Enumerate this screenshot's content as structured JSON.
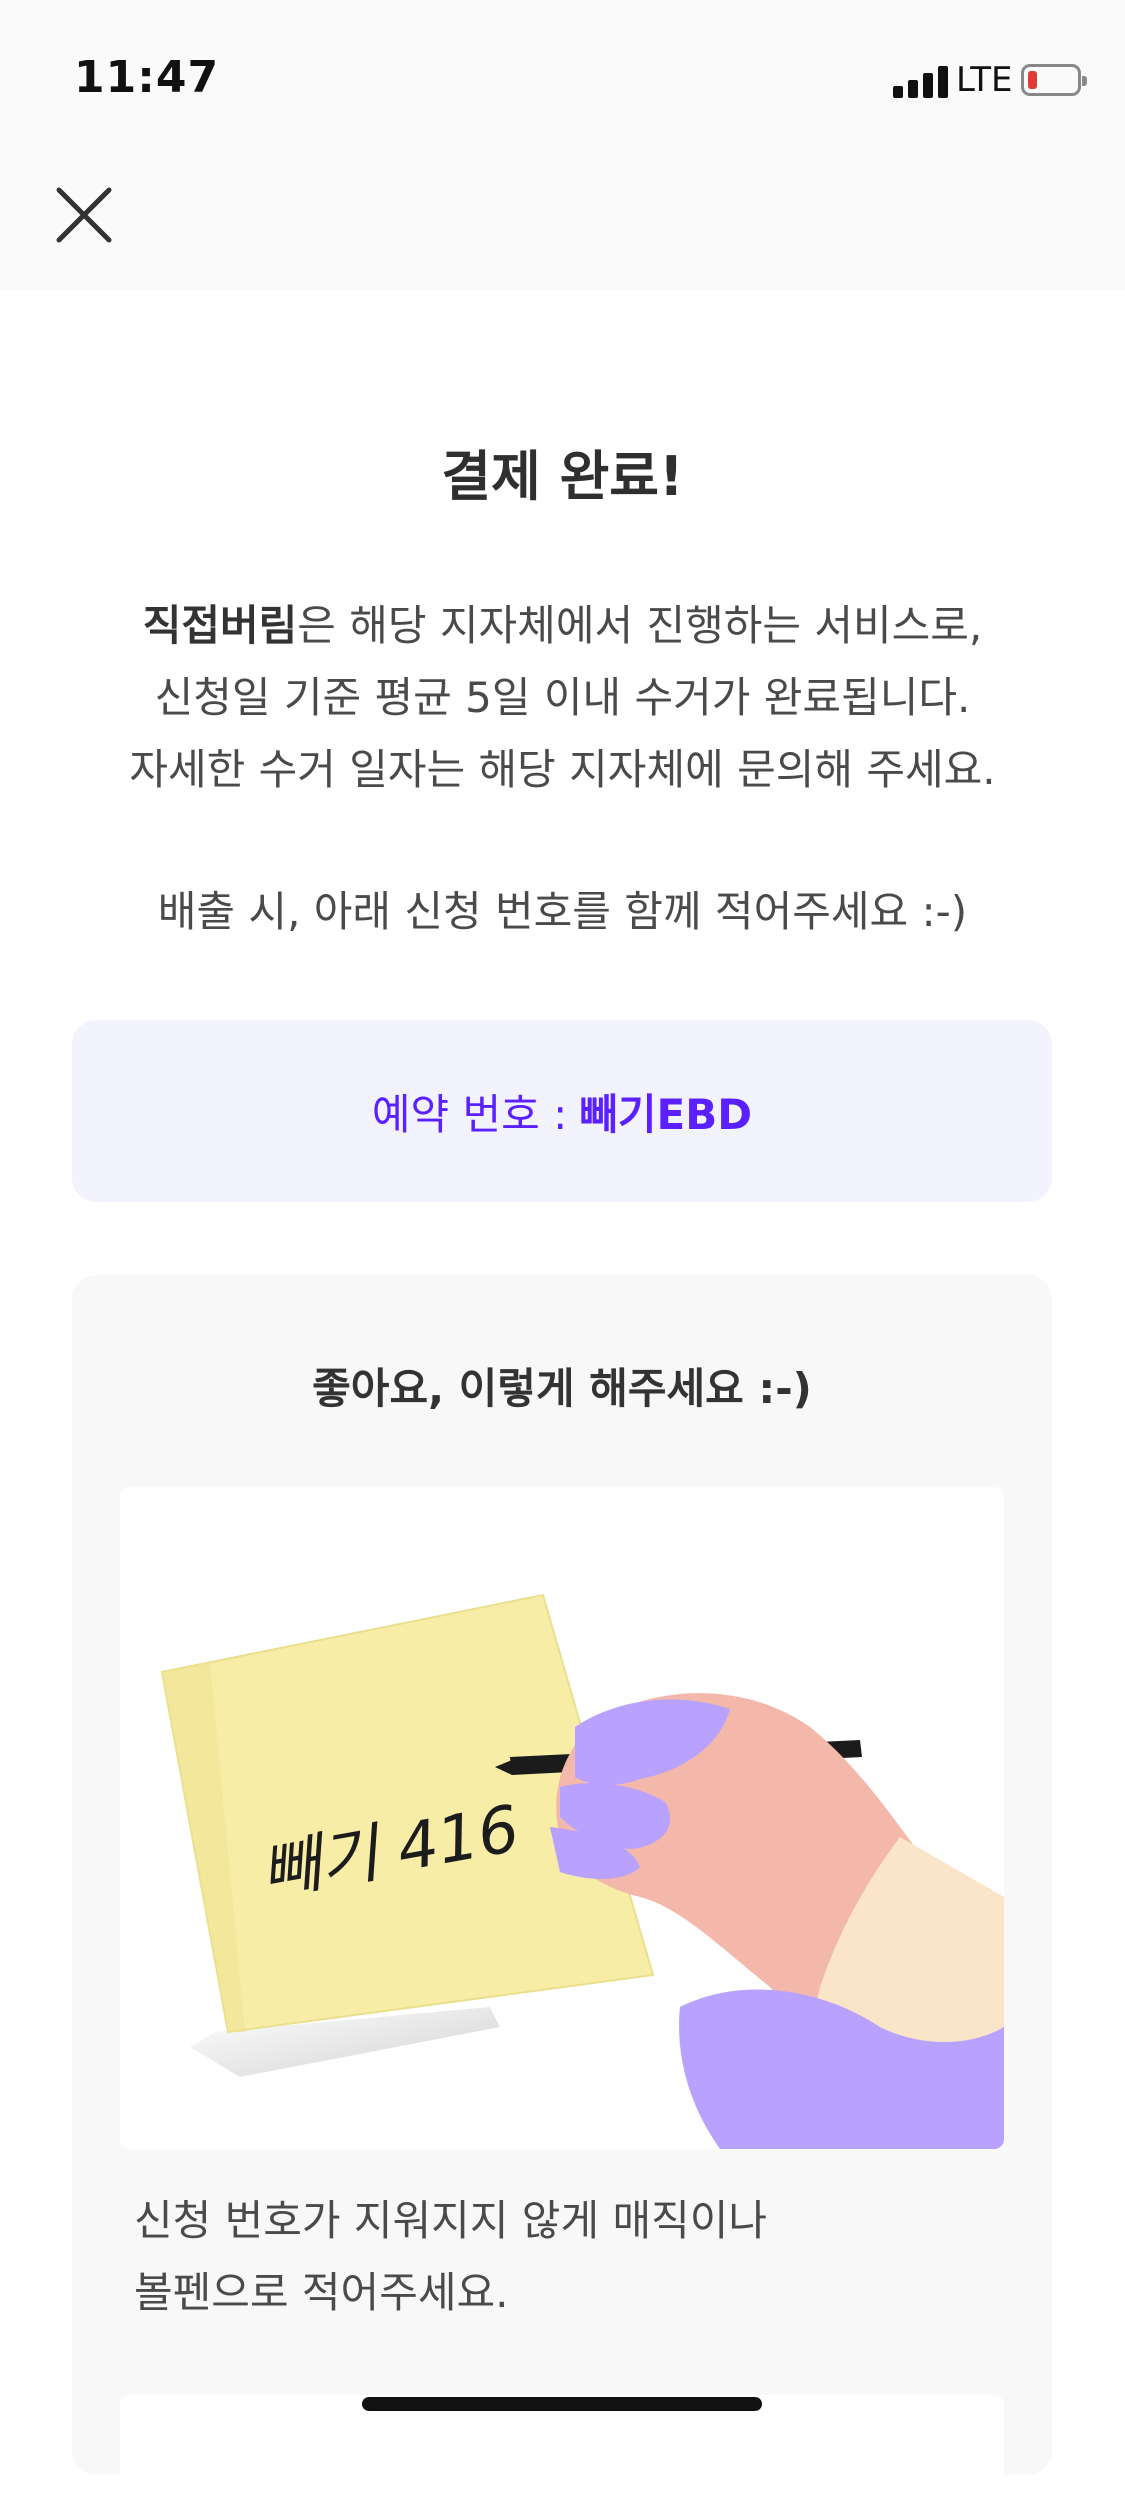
{
  "status_bar": {
    "time": "11:47",
    "network": "LTE"
  },
  "header": {
    "close_icon": "close-icon"
  },
  "page": {
    "title": "결제 완료!",
    "desc_bold": "직접버림",
    "desc_line1_rest": "은 해당 지자체에서 진행하는 서비스로,",
    "desc_line2": "신청일 기준 평균 5일 이내 수거가 완료됩니다.",
    "desc_line3": "자세한 수거 일자는 해당 지자체에 문의해 주세요.",
    "note": "배출 시, 아래 신청 번호를 함께 적어주세요 :-)"
  },
  "reservation": {
    "label": "예약 번호 :",
    "number": "빼기EBD"
  },
  "guide": {
    "title": "좋아요, 이렇게 해주세요 :-)",
    "illustration_text": "빼기 416",
    "text_line1": "신청 번호가 지워지지 않게 매직이나",
    "text_line2": "볼펜으로 적어주세요."
  },
  "colors": {
    "accent": "#5a20ff",
    "reservation_bg": "#f3f2ff",
    "card_bg": "#f8f8f8"
  }
}
